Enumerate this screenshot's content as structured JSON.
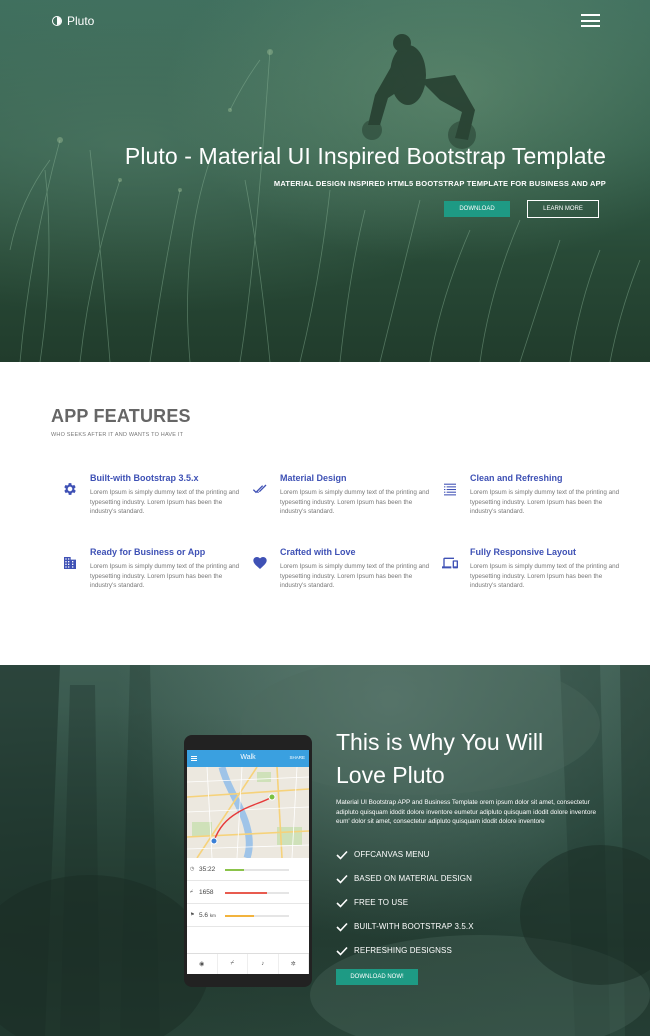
{
  "header": {
    "brand": "Pluto",
    "menu_icon": "hamburger-menu-icon"
  },
  "hero": {
    "title": "Pluto - Material UI Inspired Bootstrap Template",
    "subtitle": "MATERIAL DESIGN INSPIRED HTML5 BOOTSTRAP TEMPLATE FOR BUSINESS AND APP",
    "download_label": "DOWNLOAD",
    "learn_more_label": "LEARN MORE"
  },
  "features": {
    "heading": "APP FEATURES",
    "subheading": "WHO SEEKS AFTER IT AND WANTS TO HAVE IT",
    "items": [
      {
        "title": "Built-with Bootstrap 3.5.x",
        "text": "Lorem Ipsum is simply dummy text of the printing and typesetting industry. Lorem Ipsum has been the industry's standard.",
        "icon": "gear-icon"
      },
      {
        "title": "Material Design",
        "text": "Lorem Ipsum is simply dummy text of the printing and typesetting industry. Lorem Ipsum has been the industry's standard.",
        "icon": "double-check-icon"
      },
      {
        "title": "Clean and Refreshing",
        "text": "Lorem Ipsum is simply dummy text of the printing and typesetting industry. Lorem Ipsum has been the industry's standard.",
        "icon": "list-icon"
      },
      {
        "title": "Ready for Business or App",
        "text": "Lorem Ipsum is simply dummy text of the printing and typesetting industry. Lorem Ipsum has been the industry's standard.",
        "icon": "building-icon"
      },
      {
        "title": "Crafted with Love",
        "text": "Lorem Ipsum is simply dummy text of the printing and typesetting industry. Lorem Ipsum has been the industry's standard.",
        "icon": "heart-icon"
      },
      {
        "title": "Fully Responsive Layout",
        "text": "Lorem Ipsum is simply dummy text of the printing and typesetting industry. Lorem Ipsum has been the industry's standard.",
        "icon": "devices-icon"
      }
    ]
  },
  "why": {
    "title_line1": "This is Why You Will",
    "title_line2": "Love Pluto",
    "text": "Material UI Bootstrap APP and Business Template orem ipsum dolor sit amet, consectetur adipluto quisquam idodit dolore inventore eumetur adipluto quisquam idodit dolore inventore eum' dolor sit amet, consectetur adipluto quisquam idodit dolore inventore",
    "checklist": [
      "OFFCANVAS MENU",
      "BASED ON MATERIAL DESIGN",
      "FREE TO USE",
      "BUILT-WITH BOOTSTRAP 3.5.X",
      "REFRESHING DESIGNSS"
    ],
    "button_label": "DOWNLOAD NOW!"
  },
  "phone_app": {
    "title": "Walk",
    "share_label": "SHARE",
    "stats": [
      {
        "icon": "clock-icon",
        "value": "35:22",
        "progress": 0.3,
        "color": "#8bc34a"
      },
      {
        "icon": "steps-icon",
        "value": "1658",
        "progress": 0.65,
        "color": "#e85b4f"
      },
      {
        "icon": "flag-icon",
        "value": "5.6",
        "unit": "km",
        "progress": 0.45,
        "color": "#f2b33d"
      }
    ]
  },
  "colors": {
    "accent": "#1e9a84",
    "feature_title": "#3e51b5",
    "icon_blue": "#3f51b5",
    "app_bar": "#3aa0e0"
  }
}
